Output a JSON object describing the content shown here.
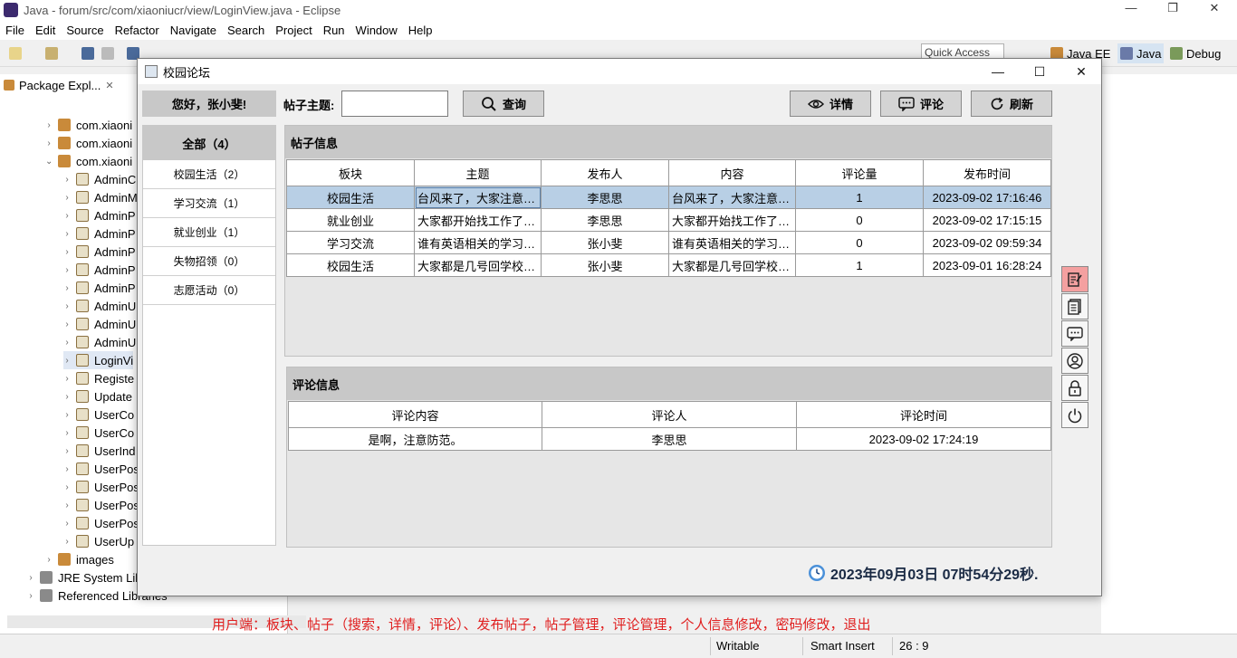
{
  "eclipse": {
    "window_title": "Java - forum/src/com/xiaoniucr/view/LoginView.java - Eclipse",
    "menu": [
      "File",
      "Edit",
      "Source",
      "Refactor",
      "Navigate",
      "Search",
      "Project",
      "Run",
      "Window",
      "Help"
    ],
    "quick_access": "Quick Access",
    "perspectives": [
      "Java EE",
      "Java",
      "Debug"
    ],
    "package_view_title": "Package Expl...",
    "tree": [
      {
        "label": "com.xiaoni",
        "kind": "pkg",
        "expanded": false
      },
      {
        "label": "com.xiaoni",
        "kind": "pkg",
        "expanded": false
      },
      {
        "label": "com.xiaoni",
        "kind": "pkg",
        "expanded": true
      },
      {
        "label": "AdminC",
        "kind": "java"
      },
      {
        "label": "AdminM",
        "kind": "java"
      },
      {
        "label": "AdminP",
        "kind": "java"
      },
      {
        "label": "AdminP",
        "kind": "java"
      },
      {
        "label": "AdminP",
        "kind": "java"
      },
      {
        "label": "AdminP",
        "kind": "java"
      },
      {
        "label": "AdminP",
        "kind": "java"
      },
      {
        "label": "AdminU",
        "kind": "java"
      },
      {
        "label": "AdminU",
        "kind": "java"
      },
      {
        "label": "AdminU",
        "kind": "java"
      },
      {
        "label": "LoginVi",
        "kind": "java"
      },
      {
        "label": "Registe",
        "kind": "java"
      },
      {
        "label": "Update",
        "kind": "java"
      },
      {
        "label": "UserCo",
        "kind": "java"
      },
      {
        "label": "UserCo",
        "kind": "java"
      },
      {
        "label": "UserInd",
        "kind": "java"
      },
      {
        "label": "UserPos",
        "kind": "java"
      },
      {
        "label": "UserPos",
        "kind": "java"
      },
      {
        "label": "UserPos",
        "kind": "java"
      },
      {
        "label": "UserPos",
        "kind": "java"
      },
      {
        "label": "UserUp",
        "kind": "java"
      },
      {
        "label": "images",
        "kind": "pkg"
      },
      {
        "label": "JRE System Lib",
        "kind": "lib"
      },
      {
        "label": "Referenced Libraries",
        "kind": "lib"
      }
    ],
    "status_message": "用户端：板块、帖子（搜索，详情，评论）、发布帖子，帖子管理，评论管理，个人信息修改，密码修改，退出",
    "status": {
      "mode": "Writable",
      "insert": "Smart Insert",
      "position": "26 : 9"
    }
  },
  "forum": {
    "title": "校园论坛",
    "greeting": "您好，张小斐!",
    "search_label": "帖子主题:",
    "search_value": "",
    "buttons": {
      "query": "查询",
      "detail": "详情",
      "comment": "评论",
      "refresh": "刷新"
    },
    "categories": {
      "all": "全部（4）",
      "items": [
        "校园生活（2）",
        "学习交流（1）",
        "就业创业（1）",
        "失物招领（0）",
        "志愿活动（0）"
      ]
    },
    "posts": {
      "section_title": "帖子信息",
      "columns": [
        "板块",
        "主题",
        "发布人",
        "内容",
        "评论量",
        "发布时间"
      ],
      "rows": [
        [
          "校园生活",
          "台风来了，大家注意安...",
          "李思思",
          "台风来了，大家注意安...",
          "1",
          "2023-09-02 17:16:46"
        ],
        [
          "就业创业",
          "大家都开始找工作了吗?",
          "李思思",
          "大家都开始找工作了吗?",
          "0",
          "2023-09-02 17:15:15"
        ],
        [
          "学习交流",
          "谁有英语相关的学习资...",
          "张小斐",
          "谁有英语相关的学习资...",
          "0",
          "2023-09-02 09:59:34"
        ],
        [
          "校园生活",
          "大家都是几号回学校呢?",
          "张小斐",
          "大家都是几号回学校呢?",
          "1",
          "2023-09-01 16:28:24"
        ]
      ]
    },
    "comments": {
      "section_title": "评论信息",
      "columns": [
        "评论内容",
        "评论人",
        "评论时间"
      ],
      "rows": [
        [
          "是啊，注意防范。",
          "李思思",
          "2023-09-02 17:24:19"
        ]
      ]
    },
    "side_icons": [
      "edit-post-icon",
      "document-icon",
      "comment-icon",
      "user-icon",
      "lock-icon",
      "power-icon"
    ],
    "clock": "2023年09月03日 07时54分29秒.",
    "colors": {
      "selected_row": "#b8cfe5",
      "active_icon": "#f4a0a0",
      "header_gray": "#c8c8c8"
    }
  }
}
